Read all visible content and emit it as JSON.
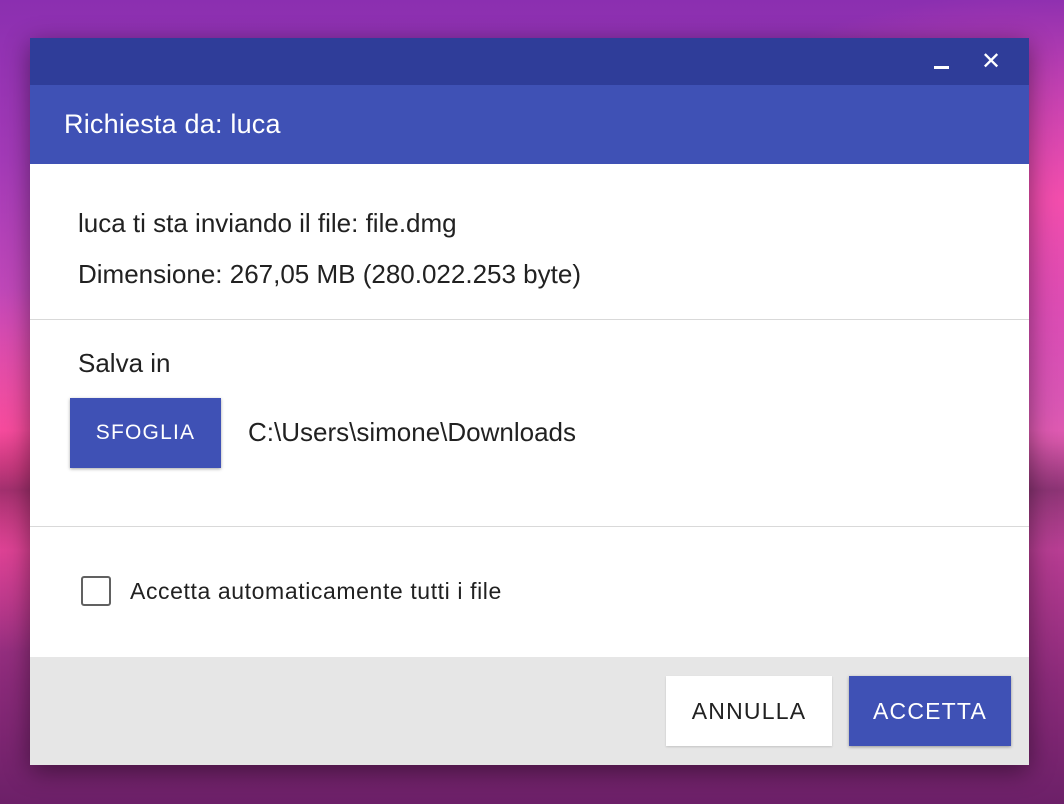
{
  "window": {
    "minimize_icon": "minimize-icon",
    "close_icon": "close-icon",
    "close_glyph": "✕"
  },
  "header": {
    "title": "Richiesta da: luca"
  },
  "info": {
    "sender_line": "luca ti sta inviando il file: file.dmg",
    "size_line": "Dimensione: 267,05 MB (280.022.253 byte)"
  },
  "save": {
    "label": "Salva in",
    "browse_label": "SFOGLIA",
    "path": "C:\\Users\\simone\\Downloads"
  },
  "auto_accept": {
    "checked": false,
    "label": "Accetta automaticamente tutti i file"
  },
  "footer": {
    "cancel_label": "ANNULLA",
    "accept_label": "ACCETTA"
  },
  "colors": {
    "titlebar": "#2f3d99",
    "header": "#3f51b5",
    "primary_button": "#3f51b5",
    "footer": "#e6e6e6"
  }
}
